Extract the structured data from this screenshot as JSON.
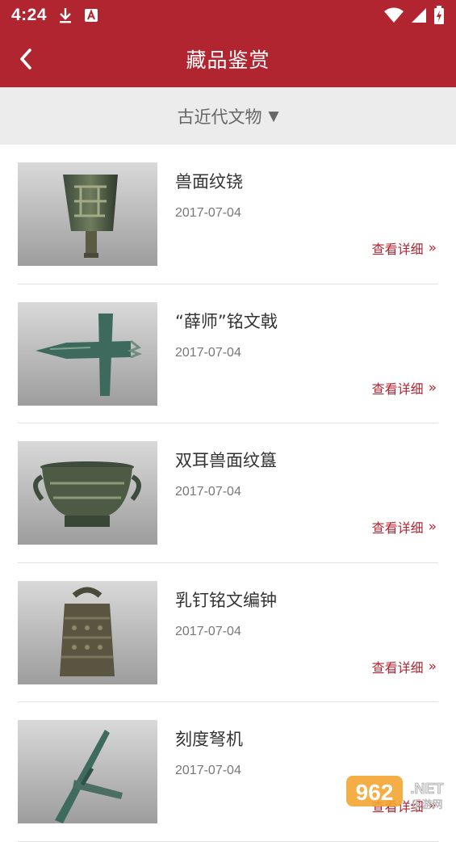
{
  "status_bar": {
    "time": "4:24",
    "icons": [
      "download-icon",
      "accessibility-icon",
      "wifi-icon",
      "signal-icon",
      "battery-icon"
    ]
  },
  "header": {
    "title": "藏品鉴赏",
    "back_icon": "chevron-left-icon"
  },
  "filter": {
    "label": "古近代文物",
    "arrow": "▼"
  },
  "items": [
    {
      "name": "兽面纹铙",
      "date": "2017-07-04",
      "more": "查看详细",
      "chev": "»"
    },
    {
      "name": "“薛师”铭文戟",
      "date": "2017-07-04",
      "more": "查看详细",
      "chev": "»"
    },
    {
      "name": "双耳兽面纹簋",
      "date": "2017-07-04",
      "more": "查看详细",
      "chev": "»"
    },
    {
      "name": "乳钉铭文编钟",
      "date": "2017-07-04",
      "more": "查看详细",
      "chev": "»"
    },
    {
      "name": "刻度弩机",
      "date": "2017-07-04",
      "more": "查看详细",
      "chev": "»"
    }
  ],
  "watermark": {
    "brand": "962",
    "domain": ".NET",
    "sub": "乐游网"
  },
  "colors": {
    "brand_red": "#b12531",
    "filter_bg": "#ececec",
    "divider": "#e2e2e2"
  }
}
